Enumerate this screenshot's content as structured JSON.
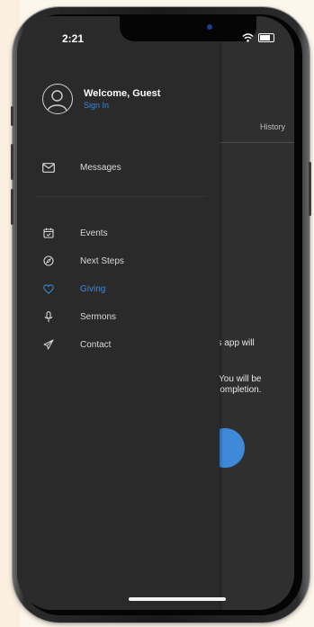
{
  "status_bar": {
    "time": "2:21"
  },
  "profile": {
    "welcome": "Welcome, Guest",
    "sign_in": "Sign In"
  },
  "menu": {
    "messages": {
      "label": "Messages",
      "icon": "envelope-icon"
    },
    "items": [
      {
        "label": "Events",
        "icon": "calendar-icon",
        "active": false
      },
      {
        "label": "Next Steps",
        "icon": "compass-icon",
        "active": false
      },
      {
        "label": "Giving",
        "icon": "heart-icon",
        "active": true
      },
      {
        "label": "Sermons",
        "icon": "microphone-icon",
        "active": false
      },
      {
        "label": "Contact",
        "icon": "paper-plane-icon",
        "active": false
      }
    ]
  },
  "background": {
    "tab_label": "History",
    "text_line1": "this app will",
    "text_line2": "w. You will be",
    "text_line3": "n completion."
  },
  "colors": {
    "accent": "#3d86d8",
    "drawer": "#2a2a2a",
    "background": "#2f2f2f"
  }
}
